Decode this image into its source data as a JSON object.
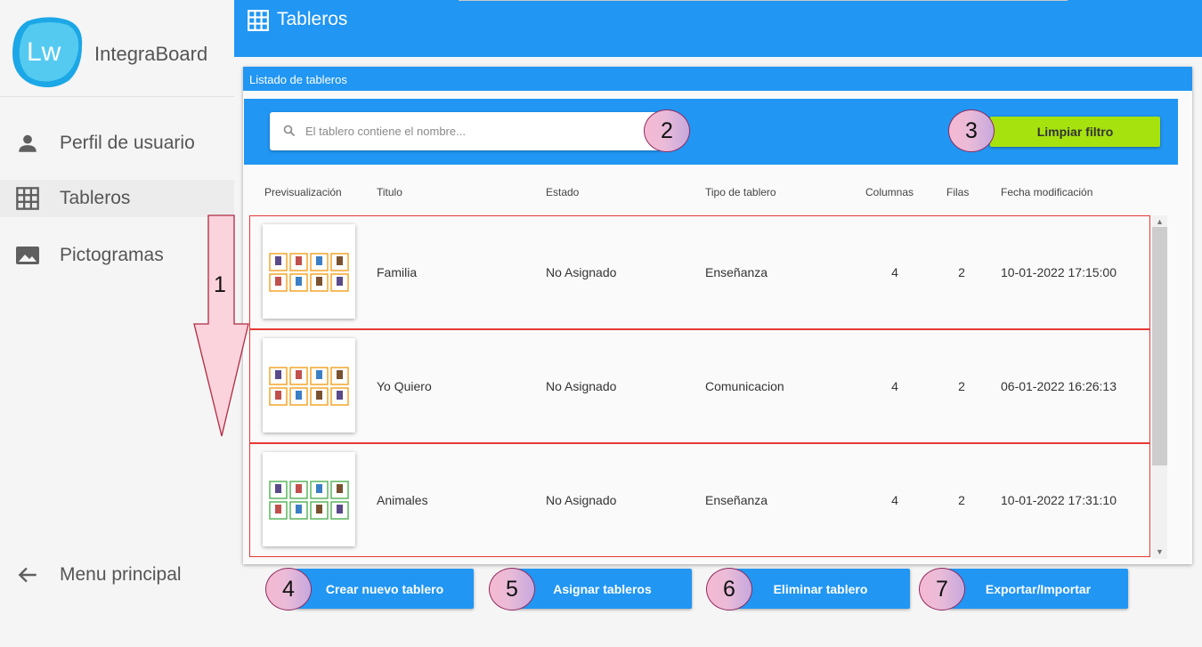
{
  "app": {
    "logo_text": "Lw",
    "name": "IntegraBoard"
  },
  "sidebar": {
    "items": [
      {
        "label": "Perfil de usuario",
        "icon": "person-icon"
      },
      {
        "label": "Tableros",
        "icon": "grid-icon",
        "active": true
      },
      {
        "label": "Pictogramas",
        "icon": "image-icon"
      }
    ],
    "back_label": "Menu principal"
  },
  "header": {
    "title": "Tableros"
  },
  "panel": {
    "title": "Listado de tableros",
    "search_placeholder": "El tablero contiene el nombre...",
    "clear_filter_label": "Limpiar filtro"
  },
  "table": {
    "headers": [
      "Previsualización",
      "Titulo",
      "Estado",
      "Tipo de tablero",
      "Columnas",
      "Filas",
      "Fecha modificación"
    ],
    "rows": [
      {
        "title": "Familia",
        "status": "No Asignado",
        "type": "Enseñanza",
        "columns": "4",
        "rows": "2",
        "modified": "10-01-2022 17:15:00",
        "frame_color": "#f4a52c"
      },
      {
        "title": "Yo Quiero",
        "status": "No Asignado",
        "type": "Comunicacion",
        "columns": "4",
        "rows": "2",
        "modified": "06-01-2022 16:26:13",
        "frame_color": "#f4a52c"
      },
      {
        "title": "Animales",
        "status": "No Asignado",
        "type": "Enseñanza",
        "columns": "4",
        "rows": "2",
        "modified": "10-01-2022 17:31:10",
        "frame_color": "#5bb55f"
      }
    ]
  },
  "actions": {
    "create": "Crear nuevo tablero",
    "assign": "Asignar tableros",
    "delete": "Eliminar tablero",
    "export": "Exportar/Importar"
  },
  "callouts": [
    "1",
    "2",
    "3",
    "4",
    "5",
    "6",
    "7"
  ],
  "colors": {
    "primary": "#2196f3",
    "accent_green": "#a6e30e",
    "row_border": "#e53935"
  }
}
